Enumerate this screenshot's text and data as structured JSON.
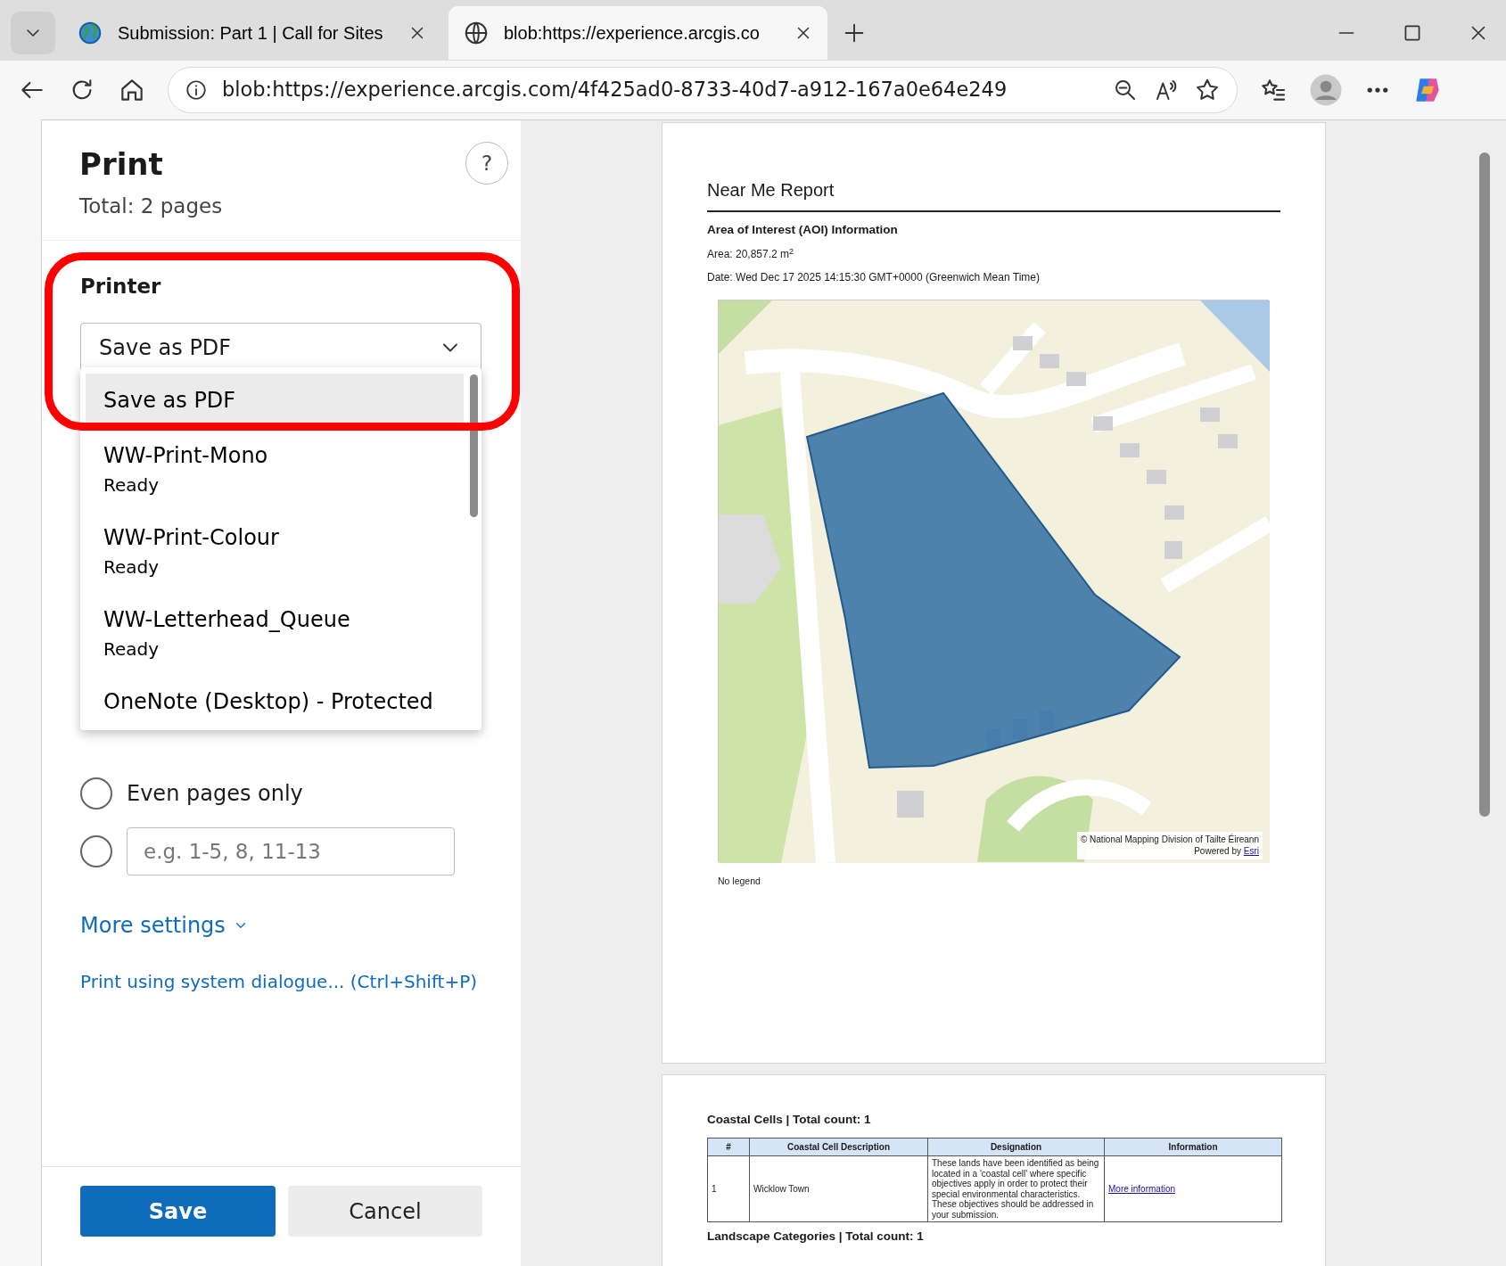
{
  "browser": {
    "tabs": [
      {
        "title": "Submission: Part 1 | Call for Sites",
        "selected": false
      },
      {
        "title": "blob:https://experience.arcgis.co",
        "selected": true
      }
    ],
    "url": "blob:https://experience.arcgis.com/4f425ad0-8733-40d7-a912-167a0e64e249"
  },
  "print_dialog": {
    "title": "Print",
    "total": "Total: 2 pages",
    "help": "?",
    "printer_label": "Printer",
    "printer_value": "Save as PDF",
    "printer_options": [
      {
        "name": "Save as PDF",
        "selected": true
      },
      {
        "name": "WW-Print-Mono",
        "status": "Ready",
        "selected": false
      },
      {
        "name": "WW-Print-Colour",
        "status": "Ready",
        "selected": false
      },
      {
        "name": "WW-Letterhead_Queue",
        "status": "Ready",
        "selected": false
      },
      {
        "name": "OneNote (Desktop) - Protected",
        "selected": false
      }
    ],
    "page_options": [
      {
        "kind": "radio",
        "label": "Even pages only",
        "selected": false
      },
      {
        "kind": "range",
        "placeholder": "e.g. 1-5, 8, 11-13",
        "selected": false
      }
    ],
    "more_settings": "More settings",
    "system_dialog_link": "Print using system dialogue... (Ctrl+Shift+P)",
    "buttons": [
      {
        "label": "Save",
        "kind": "primary"
      },
      {
        "label": "Cancel",
        "kind": "secondary"
      }
    ]
  },
  "preview": {
    "page_1": {
      "title": "Near Me Report",
      "section": "Area of Interest (AOI) Information",
      "area": "Area: 20,857.2 m$^{2}$",
      "date": "Date: Wed Dec 17 2025 14:15:30 GMT+0000 (Greenwich Mean Time)",
      "map_attribution": "© National Mapping Division of Tailte Éireann",
      "map_powered_by": "Powered by",
      "map_powered_link": "Esri",
      "legend": "No legend"
    },
    "page_2": {
      "section": "Coastal Cells | Total count: 1",
      "table": {
        "columns": [
          "#",
          "Coastal Cell Description",
          "Designation",
          "Information"
        ],
        "rows": [
          [
            "1",
            "Wicklow Town",
            "These lands have been identified as being located in a 'coastal cell' where specific objectives apply in order to protect their special environmental characteristics. These objectives should be addressed in your submission.",
            "More information"
          ]
        ]
      },
      "next_section": "Landscape Categories | Total count: 1"
    }
  }
}
